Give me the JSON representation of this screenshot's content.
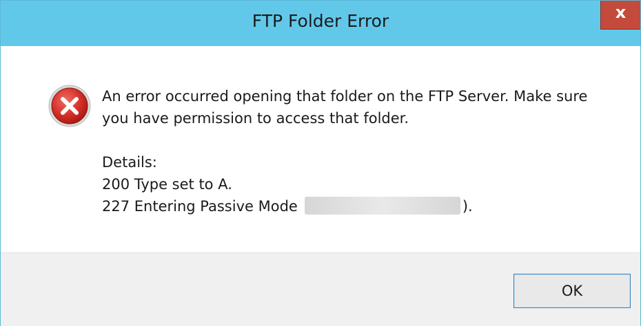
{
  "window": {
    "title": "FTP Folder Error",
    "close_glyph": "x",
    "accent_color": "#62c8ea",
    "close_color": "#c44a3b"
  },
  "content": {
    "icon": "error-icon",
    "message": "An error occurred opening that folder on the FTP Server.  Make sure you have permission to access that folder.",
    "details_label": "Details:",
    "details_line_1": "200 Type set to A.",
    "details_line_2_prefix": "227 Entering Passive Mode",
    "details_line_2_suffix": ")."
  },
  "footer": {
    "ok_label": "OK"
  }
}
